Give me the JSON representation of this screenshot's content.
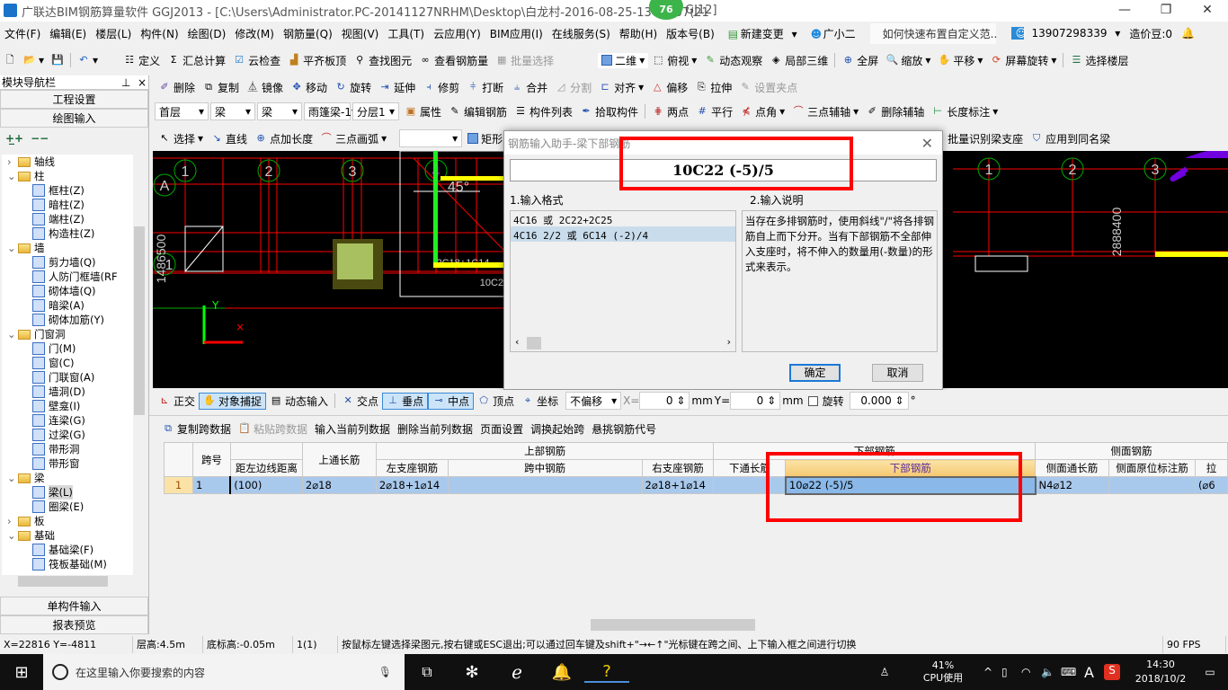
{
  "window": {
    "title": "广联达BIM钢筋算量软件 GGJ2013 - [C:\\Users\\Administrator.PC-20141127NRHM\\Desktop\\白龙村-2016-08-25-13-27-07(21",
    "title_tail": "GJ12]",
    "badge": "76",
    "minimize": "—",
    "restore": "❐",
    "close": "✕"
  },
  "menu": [
    "文件(F)",
    "编辑(E)",
    "楼层(L)",
    "构件(N)",
    "绘图(D)",
    "修改(M)",
    "钢筋量(Q)",
    "视图(V)",
    "工具(T)",
    "云应用(Y)",
    "BIM应用(I)",
    "在线服务(S)",
    "帮助(H)",
    "版本号(B)"
  ],
  "menu_right": {
    "new_change": "新建变更",
    "assistant": "广小二",
    "tip": "如何快速布置自定义范..",
    "user": "13907298339",
    "beans": "造价豆:0"
  },
  "toolbar1": [
    "定义",
    "汇总计算",
    "云检查",
    "平齐板顶",
    "查找图元",
    "查看钢筋量",
    "批量选择"
  ],
  "toolbar1_right": [
    "二维",
    "俯视",
    "动态观察",
    "局部三维",
    "全屏",
    "缩放",
    "平移",
    "屏幕旋转",
    "选择楼层"
  ],
  "toolbar2": [
    "删除",
    "复制",
    "镜像",
    "移动",
    "旋转",
    "延伸",
    "修剪",
    "打断",
    "合并",
    "分割",
    "对齐",
    "偏移",
    "拉伸",
    "设置夹点"
  ],
  "toolbar3": {
    "selects": [
      "首层",
      "梁",
      "梁",
      "雨篷梁-1",
      "分层1"
    ],
    "buttons": [
      "属性",
      "编辑钢筋",
      "构件列表",
      "拾取构件",
      "两点",
      "平行",
      "点角",
      "三点辅轴",
      "删除辅轴",
      "长度标注"
    ]
  },
  "toolbar4": {
    "left": [
      "选择",
      "直线",
      "点加长度",
      "三点画弧",
      "矩形"
    ],
    "right": [
      "批量识别梁支座",
      "应用到同名梁"
    ]
  },
  "nav": {
    "title": "模块导航栏",
    "project_settings": "工程设置",
    "drawing_input": "绘图输入",
    "single_input": "单构件输入",
    "report": "报表预览",
    "tree": [
      {
        "label": "轴线",
        "level": 0,
        "type": "folder",
        "state": "collapsed"
      },
      {
        "label": "柱",
        "level": 0,
        "type": "folder",
        "state": "expanded"
      },
      {
        "label": "框柱(Z)",
        "level": 1
      },
      {
        "label": "暗柱(Z)",
        "level": 1
      },
      {
        "label": "端柱(Z)",
        "level": 1
      },
      {
        "label": "构造柱(Z)",
        "level": 1
      },
      {
        "label": "墙",
        "level": 0,
        "type": "folder",
        "state": "expanded"
      },
      {
        "label": "剪力墙(Q)",
        "level": 1
      },
      {
        "label": "人防门框墙(RF",
        "level": 1
      },
      {
        "label": "砌体墙(Q)",
        "level": 1
      },
      {
        "label": "暗梁(A)",
        "level": 1
      },
      {
        "label": "砌体加筋(Y)",
        "level": 1
      },
      {
        "label": "门窗洞",
        "level": 0,
        "type": "folder",
        "state": "expanded"
      },
      {
        "label": "门(M)",
        "level": 1
      },
      {
        "label": "窗(C)",
        "level": 1
      },
      {
        "label": "门联窗(A)",
        "level": 1
      },
      {
        "label": "墙洞(D)",
        "level": 1
      },
      {
        "label": "壁龛(I)",
        "level": 1
      },
      {
        "label": "连梁(G)",
        "level": 1
      },
      {
        "label": "过梁(G)",
        "level": 1
      },
      {
        "label": "带形洞",
        "level": 1
      },
      {
        "label": "带形窗",
        "level": 1
      },
      {
        "label": "梁",
        "level": 0,
        "type": "folder",
        "state": "expanded"
      },
      {
        "label": "梁(L)",
        "level": 1,
        "selected": true
      },
      {
        "label": "圈梁(E)",
        "level": 1
      },
      {
        "label": "板",
        "level": 0,
        "type": "folder",
        "state": "collapsed"
      },
      {
        "label": "基础",
        "level": 0,
        "type": "folder",
        "state": "expanded"
      },
      {
        "label": "基础梁(F)",
        "level": 1
      },
      {
        "label": "筏板基础(M)",
        "level": 1
      }
    ]
  },
  "canvas": {
    "axes_top": [
      "1",
      "2",
      "3",
      "4"
    ],
    "axis_row": "A",
    "axis_left": "1",
    "dims_left": "1486500",
    "dims_right": "2888400",
    "angle": "45°",
    "rebar_label1": "2C18+1C14",
    "rebar_label2": "10C22",
    "y_label": "Y"
  },
  "dialog": {
    "title": "钢筋输入助手-梁下部钢筋",
    "value": "10C22 (-5)/5",
    "format_label": "1.输入格式",
    "desc_label": "2.输入说明",
    "formats": [
      "4C16 或 2C22+2C25",
      "4C16 2/2 或 6C14 (-2)/4"
    ],
    "description": "当存在多排钢筋时，使用斜线\"/\"将各排钢筋自上而下分开。当有下部钢筋不全部伸入支座时，将不伸入的数量用(-数量)的形式来表示。",
    "ok": "确定",
    "cancel": "取消"
  },
  "snapbar": {
    "items": [
      "正交",
      "对象捕捉",
      "动态输入",
      "交点",
      "垂点",
      "中点",
      "顶点",
      "坐标"
    ],
    "offset": "不偏移",
    "x_label": "X=",
    "x": "0",
    "y_label": "Y=",
    "y": "0",
    "unit": "mm",
    "rotate_label": "旋转",
    "rotate": "0.000",
    "deg": "°"
  },
  "gridbar": [
    "复制跨数据",
    "粘贴跨数据",
    "输入当前列数据",
    "删除当前列数据",
    "页面设置",
    "调换起始跨",
    "悬挑钢筋代号"
  ],
  "table": {
    "h_span": "跨号",
    "h_dist": "距左边线距离",
    "h_top_cont": "上通长筋",
    "g_top": "上部钢筋",
    "h_left": "左支座钢筋",
    "h_mid": "跨中钢筋",
    "h_right": "右支座钢筋",
    "g_bottom": "下部钢筋",
    "h_bot_cont": "下通长筋",
    "h_bottom": "下部钢筋",
    "g_side": "侧面钢筋",
    "h_side_cont": "侧面通长筋",
    "h_side_orig": "侧面原位标注筋",
    "h_more": "拉",
    "rows": [
      {
        "num": "1",
        "span": "1",
        "dist": "(100)",
        "top_cont": "2⌀18",
        "left": "2⌀18+1⌀14",
        "mid": "",
        "right": "2⌀18+1⌀14",
        "bot_cont": "",
        "bottom": "10⌀22 (-5)/5",
        "side_cont": "N4⌀12",
        "side_orig": "",
        "more": "(⌀6"
      }
    ]
  },
  "status": {
    "coords": "X=22816 Y=-4811",
    "floor_h": "层高:4.5m",
    "base_h": "底标高:-0.05m",
    "count": "1(1)",
    "hint": "按鼠标左键选择梁图元,按右键或ESC退出;可以通过回车键及shift+\"→←↑\"光标键在跨之间、上下输入框之间进行切换",
    "fps": "90 FPS"
  },
  "taskbar": {
    "search": "在这里输入你要搜索的内容",
    "cpu": "41%",
    "cpu_label": "CPU使用",
    "ime": "A",
    "time": "14:30",
    "date": "2018/10/2"
  }
}
